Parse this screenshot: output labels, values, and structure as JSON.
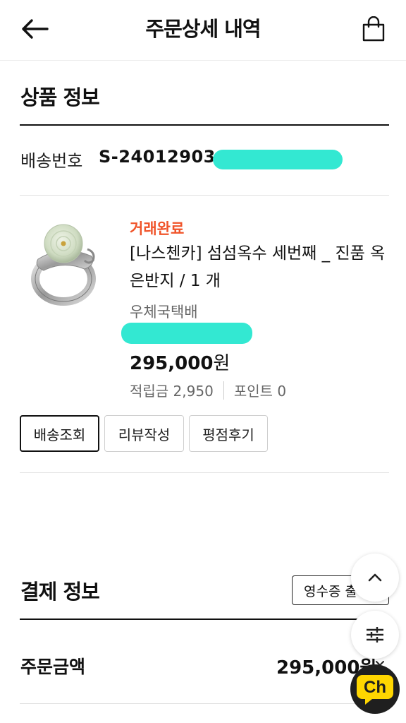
{
  "header": {
    "title": "주문상세 내역",
    "back_icon": "arrow-left-icon",
    "cart_icon": "shopping-bag-icon"
  },
  "product_section": {
    "title": "상품 정보",
    "shipping_number_label": "배송번호",
    "shipping_number_value": "S-24012903-",
    "item": {
      "status": "거래완료",
      "name": "[나스첸카] 섬섬옥수 세번째 _ 진품 옥 은반지 / 1 개",
      "shipping_method": "우체국택배",
      "price_number": "295,000",
      "price_unit": "원",
      "reward_points": "적립금 2,950",
      "points": "포인트 0"
    },
    "buttons": {
      "track": "배송조회",
      "review": "리뷰작성",
      "rating": "평점후기"
    }
  },
  "payment_section": {
    "title": "결제 정보",
    "receipt_button": "영수증 출",
    "total_label": "주문금액",
    "total_value": "295,000원"
  },
  "floating": {
    "scroll_top_icon": "chevron-up-icon",
    "filter_icon": "sliders-icon",
    "channel_label": "Ch"
  },
  "colors": {
    "status": "#f0542a",
    "redaction": "#33e8d2",
    "channel_bg": "#1f1f1f",
    "channel_fg": "#ffd600"
  }
}
